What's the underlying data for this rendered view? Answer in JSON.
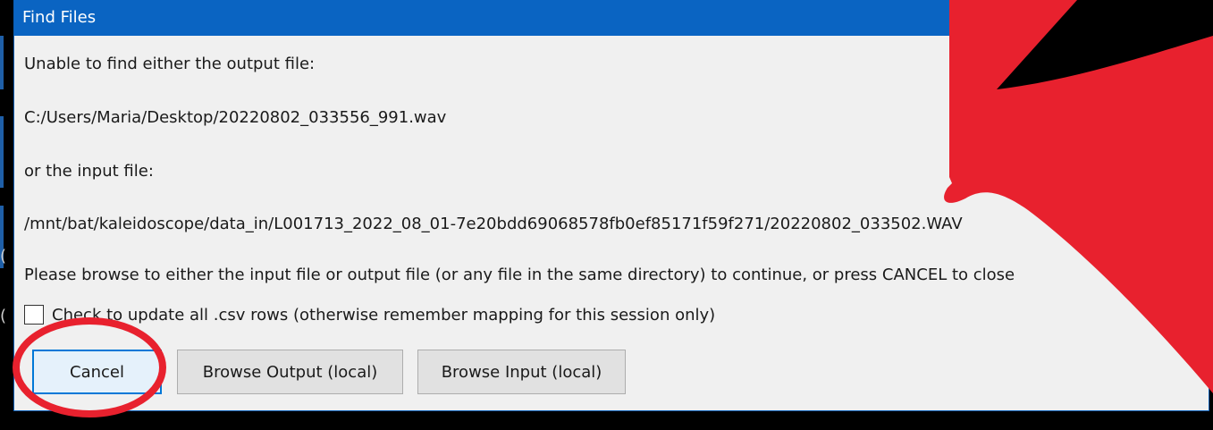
{
  "window": {
    "title": "Find Files"
  },
  "message": {
    "line1": "Unable to find either the output file:",
    "output_path": "C:/Users/Maria/Desktop/20220802_033556_991.wav",
    "line3": "or the input file:",
    "input_path": "/mnt/bat/kaleidoscope/data_in/L001713_2022_08_01-7e20bdd69068578fb0ef85171f59f271/20220802_033502.WAV",
    "instruction": "Please browse to either the input file or output file (or any file in the same directory) to continue, or press CANCEL to close"
  },
  "option": {
    "checked": false,
    "label": "Check to update all .csv rows (otherwise remember mapping for this session only)"
  },
  "buttons": {
    "cancel": "Cancel",
    "browse_output": "Browse Output (local)",
    "browse_input": "Browse Input (local)"
  },
  "colors": {
    "title_bar": "#0a64c2",
    "annotation": "#e8212e",
    "focus": "#0078d7"
  }
}
